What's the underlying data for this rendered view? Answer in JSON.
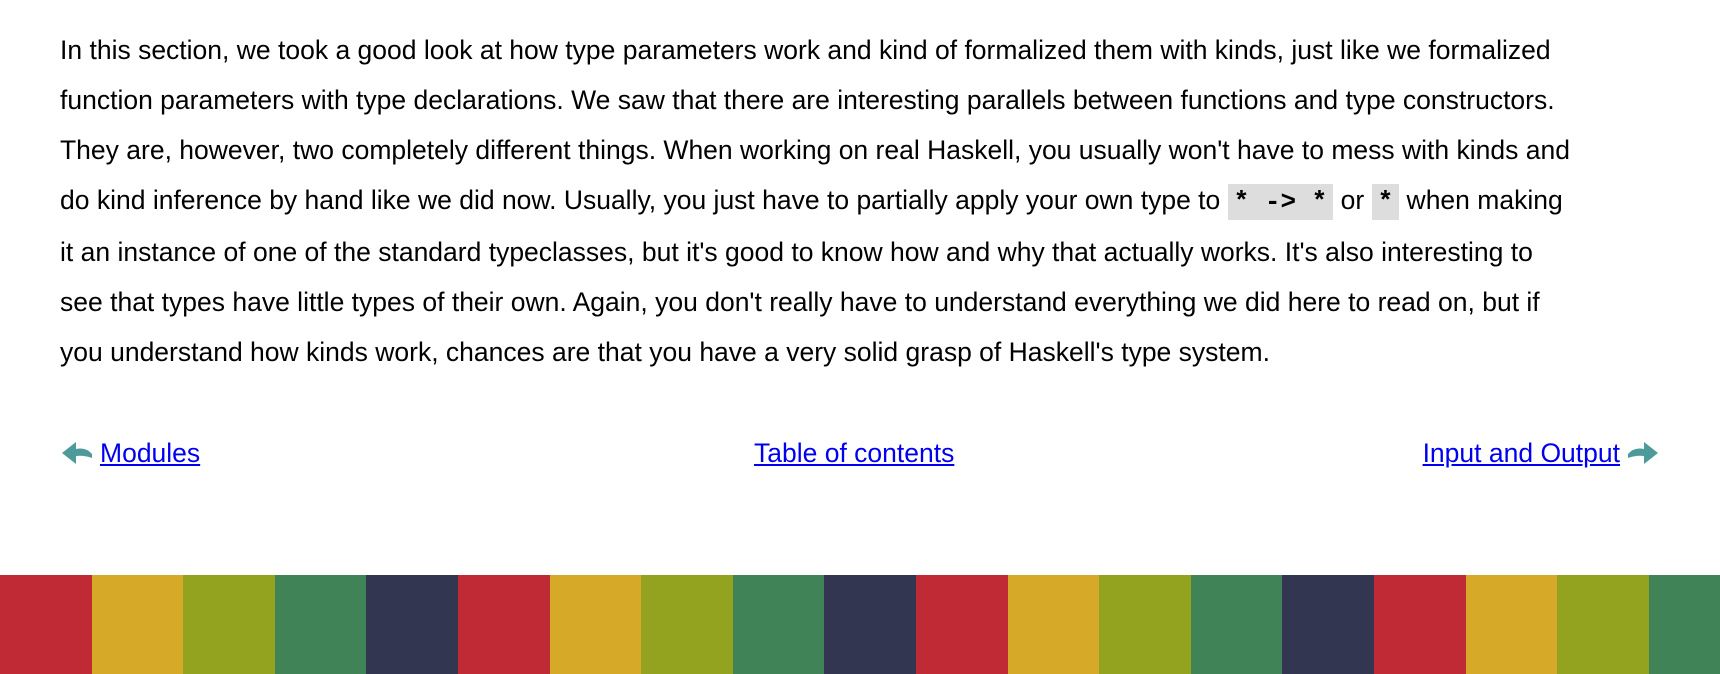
{
  "paragraph": {
    "line1": "In this section, we took a good look at how type parameters work and kind of formalized them with kinds, just like we formalized",
    "line2": "function parameters with type declarations. We saw that there are interesting parallels between functions and type constructors.",
    "line3": "They are, however, two completely different things. When working on real Haskell, you usually won't have to mess with kinds and",
    "line4_a": "do kind inference by hand like we did now. Usually, you just have to partially apply your own type to ",
    "line4_code1": "* -> *",
    "line4_b": " or ",
    "line4_code2": "*",
    "line4_c": " when making",
    "line5": "it an instance of one of the standard typeclasses, but it's good to know how and why that actually works. It's also interesting to",
    "line6": "see that types have little types of their own. Again, you don't really have to understand everything we did here to read on, but if",
    "line7": "you understand how kinds work, chances are that you have a very solid grasp of Haskell's type system."
  },
  "nav": {
    "prev_label": "Modules",
    "toc_label": "Table of contents",
    "next_label": "Input and Output",
    "prev_icon": "arrow-left-icon",
    "next_icon": "arrow-right-icon",
    "arrow_color": "#4d9a9a",
    "link_color": "#0000ee"
  },
  "footer": {
    "stripe_colors": [
      "#c02a35",
      "#d7a928",
      "#94a31f",
      "#3f8357",
      "#323651",
      "#c02a35",
      "#d7a928",
      "#94a31f",
      "#3f8357",
      "#323651",
      "#c02a35",
      "#d7a928",
      "#94a31f",
      "#3f8357",
      "#323651",
      "#c02a35",
      "#d7a928",
      "#94a31f",
      "#3f8357"
    ]
  }
}
